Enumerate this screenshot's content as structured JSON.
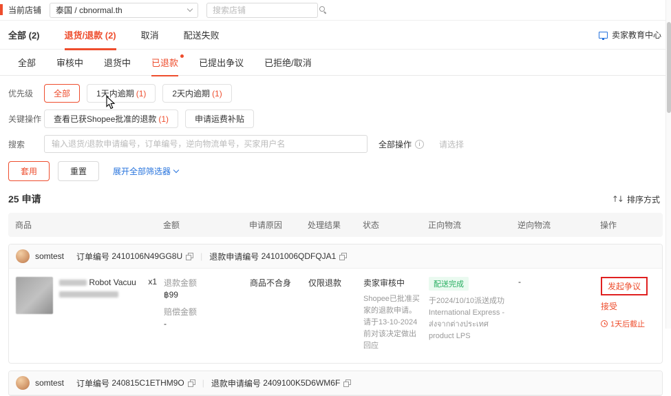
{
  "colors": {
    "accent": "#ee4d2d",
    "link": "#2673dd",
    "green": "#27ae60",
    "annotation": "#e02020"
  },
  "icons": {
    "sort_glyph": "↑↓",
    "info_glyph": "i",
    "divider": "|"
  },
  "topbar": {
    "store_label": "当前店铺",
    "store_value": "泰国 / cbnormal.th",
    "search_placeholder": "搜索店铺"
  },
  "main_tabs": {
    "items": [
      {
        "label": "全部 (2)"
      },
      {
        "label": "退货/退款 (2)"
      },
      {
        "label": "取消"
      },
      {
        "label": "配送失败"
      }
    ],
    "education_center": "卖家教育中心"
  },
  "sub_tabs": [
    "全部",
    "审核中",
    "退货中",
    "已退款",
    "已提出争议",
    "已拒绝/取消"
  ],
  "filters": {
    "priority": {
      "label": "优先级",
      "pills": [
        {
          "text": "全部",
          "count": ""
        },
        {
          "text": "1天内逾期",
          "count": "(1)"
        },
        {
          "text": "2天内逾期",
          "count": "(1)"
        }
      ]
    },
    "key_actions": {
      "label": "关键操作",
      "pills": [
        {
          "text": "查看已获Shopee批准的退款",
          "count": "(1)"
        },
        {
          "text": "申请运费补贴",
          "count": ""
        }
      ]
    },
    "search": {
      "label": "搜索",
      "placeholder": "输入退货/退款申请编号，订单编号，逆向物流单号，买家用户名"
    },
    "operation": {
      "label": "全部操作",
      "placeholder": "请选择"
    },
    "apply": "套用",
    "reset": "重置",
    "expand": "展开全部筛选器"
  },
  "summary": {
    "count": "25 申请",
    "sort": "排序方式"
  },
  "table": {
    "headers": [
      "商品",
      "金额",
      "申请原因",
      "处理结果",
      "状态",
      "正向物流",
      "逆向物流",
      "操作"
    ],
    "orders": [
      {
        "buyer": "somtest",
        "order_label": "订单编号",
        "order_no": "2410106N49GG8U",
        "refund_label": "退款申请编号",
        "refund_no": "24101006QDFQJA1",
        "product_name": "Robot Vacuu",
        "qty": "x1",
        "refund_amount_label": "退款金额",
        "refund_amount": "฿99",
        "compensation_label": "赔偿金额",
        "compensation": "-",
        "reason": "商品不合身",
        "result": "仅限退款",
        "status": "卖家审核中",
        "status_desc": "Shopee已批准买家的退款申请。请于13-10-2024前对该决定做出回应",
        "forward_badge": "配送完成",
        "forward_desc": "于2024/10/10派送成功 International Express - ส่งจากต่างประเทศ product LPS",
        "reverse": "-",
        "action_dispute": "发起争议",
        "action_accept": "接受",
        "deadline": "1天后截止"
      },
      {
        "buyer": "somtest",
        "order_label": "订单编号",
        "order_no": "240815C1ETHM9O",
        "refund_label": "退款申请编号",
        "refund_no": "2409100K5D6WM6F"
      }
    ]
  }
}
